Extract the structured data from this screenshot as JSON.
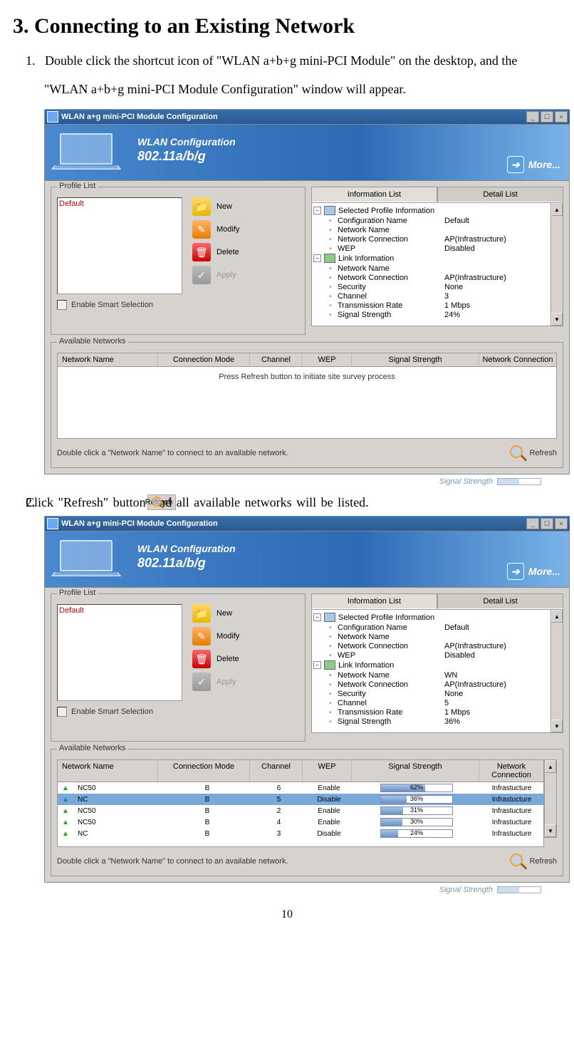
{
  "heading": "3. Connecting to an Existing Network",
  "step_1_num": "1.",
  "step_1": "Double click the shortcut icon of \"WLAN a+b+g mini-PCI Module\" on the desktop, and the \"WLAN a+b+g mini-PCI Module Configuration\" window will appear.",
  "step_2_num": "2.",
  "step_2a": "Click \"Refresh\" button ",
  "step_2b": "nd all available networks will be listed.",
  "inline_refresh": "Refresh",
  "page_number": "10",
  "win": {
    "title": "WLAN a+g mini-PCI Module Configuration",
    "banner_line1": "WLAN Configuration",
    "banner_line2": "802.11a/b/g",
    "more": "More...",
    "profile_list_label": "Profile List",
    "profile_default": "Default",
    "btn_new": "New",
    "btn_modify": "Modify",
    "btn_delete": "Delete",
    "btn_apply": "Apply",
    "enable_smart": "Enable Smart Selection",
    "tab_info": "Information List",
    "tab_detail": "Detail List",
    "sec_profile": "Selected Profile Information",
    "sec_link": "Link Information",
    "k_confname": "Configuration Name",
    "k_netname": "Network Name",
    "k_netconn": "Network Connection",
    "k_wep": "WEP",
    "k_security": "Security",
    "k_channel": "Channel",
    "k_txrate": "Transmission Rate",
    "k_sigstr": "Signal Strength",
    "avail_label": "Available Networks",
    "col_name": "Network Name",
    "col_mode": "Connection Mode",
    "col_channel": "Channel",
    "col_wep": "WEP",
    "col_sig": "Signal Strength",
    "col_conn": "Network Connection",
    "empty_msg": "Press Refresh button to initiate site survey process",
    "dblclick_hint": "Double click a \"Network Name\" to connect to an available network.",
    "refresh": "Refresh",
    "sigstr_footer": "Signal Strength"
  },
  "info1": {
    "confname": "Default",
    "netname": "",
    "netconn": "AP(Infrastructure)",
    "wep": "Disabled",
    "link_netname": "",
    "link_netconn": "AP(Infrastructure)",
    "link_security": "None",
    "link_channel": "3",
    "link_txrate": "1 Mbps",
    "link_sigstr": "24%"
  },
  "info2": {
    "confname": "Default",
    "netname": "",
    "netconn": "AP(Infrastructure)",
    "wep": "Disabled",
    "link_netname": "WN",
    "link_netconn": "AP(Infrastructure)",
    "link_security": "None",
    "link_channel": "5",
    "link_txrate": "1 Mbps",
    "link_sigstr": "36%"
  },
  "networks": [
    {
      "name": "NC50",
      "mode": "B",
      "chan": "6",
      "wep": "Enable",
      "sig": "62%",
      "sigw": 62,
      "conn": "Infrastucture",
      "sel": false
    },
    {
      "name": "NC",
      "mode": "B",
      "chan": "5",
      "wep": "Disable",
      "sig": "36%",
      "sigw": 36,
      "conn": "Infrastucture",
      "sel": true
    },
    {
      "name": "NC50",
      "mode": "B",
      "chan": "2",
      "wep": "Enable",
      "sig": "31%",
      "sigw": 31,
      "conn": "Infrastucture",
      "sel": false
    },
    {
      "name": "NC50",
      "mode": "B",
      "chan": "4",
      "wep": "Enable",
      "sig": "30%",
      "sigw": 30,
      "conn": "Infrastucture",
      "sel": false
    },
    {
      "name": "NC",
      "mode": "B",
      "chan": "3",
      "wep": "Disable",
      "sig": "24%",
      "sigw": 24,
      "conn": "Infrastucture",
      "sel": false
    }
  ]
}
